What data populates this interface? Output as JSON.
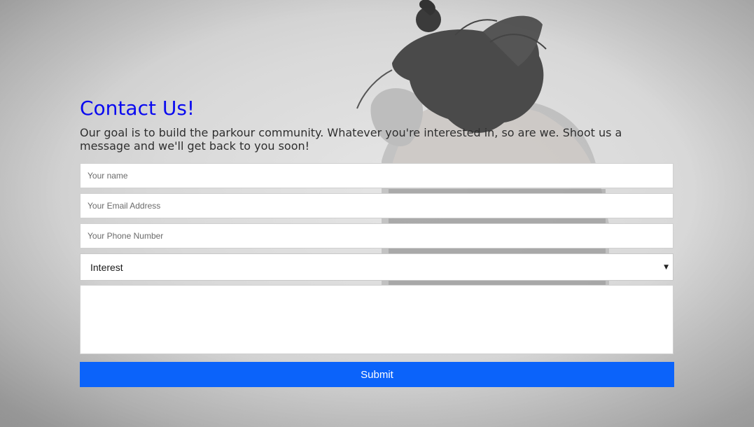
{
  "contact": {
    "title": "Contact Us!",
    "intro": "Our goal is to build the parkour community. Whatever you're interested in, so are we. Shoot us a message and we'll get back to you soon!",
    "name_placeholder": "Your name",
    "email_placeholder": "Your Email Address",
    "phone_placeholder": "Your Phone Number",
    "interest_value": "Interest",
    "message_placeholder": "",
    "submit_label": "Submit"
  },
  "colors": {
    "title": "#0a0af0",
    "submit_bg": "#0b63fa",
    "submit_text": "#ffffff"
  },
  "icons": {
    "select_caret": "caret-down-icon"
  }
}
